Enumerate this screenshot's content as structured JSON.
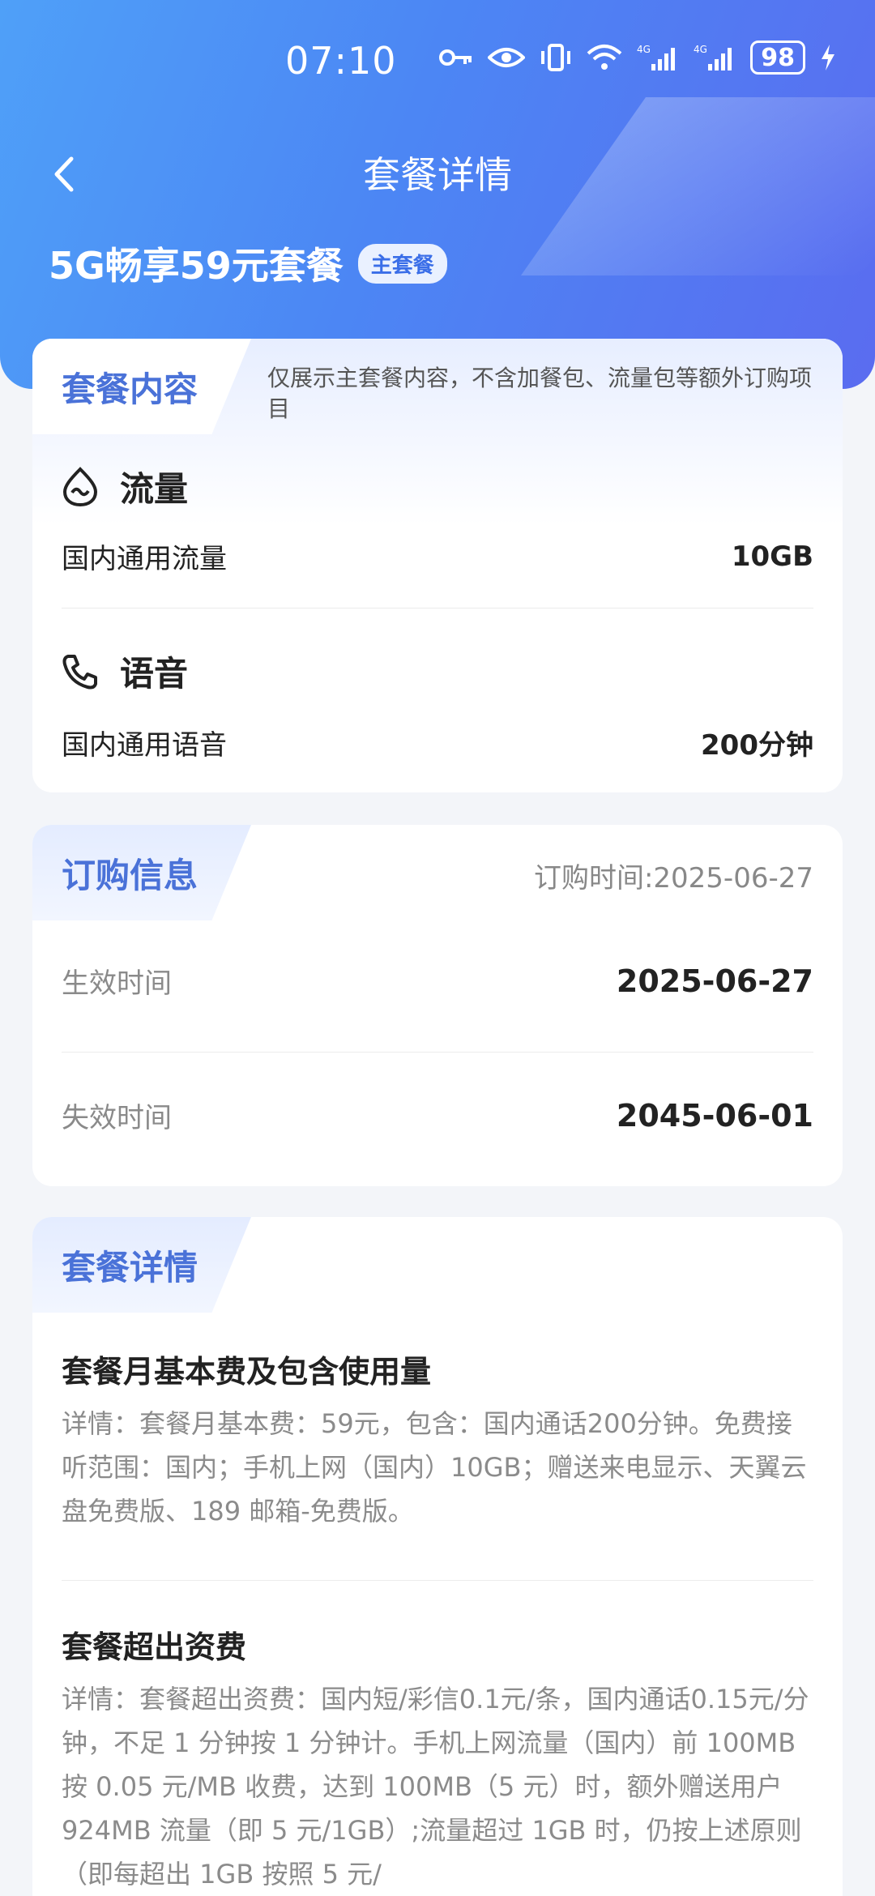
{
  "status_bar": {
    "time": "07:10",
    "battery": "98",
    "icons": [
      "key-icon",
      "eye-icon",
      "vibrate-icon",
      "wifi-icon",
      "signal-4g-icon",
      "signal-4g-icon",
      "charging-icon"
    ]
  },
  "nav": {
    "title": "套餐详情",
    "back_icon": "chevron-left-icon"
  },
  "plan": {
    "name": "5G畅享59元套餐",
    "badge": "主套餐"
  },
  "package_content": {
    "tab": "套餐内容",
    "note": "仅展示主套餐内容，不含加餐包、流量包等额外订购项目",
    "data": {
      "title": "流量",
      "icon": "data-drop-icon",
      "label": "国内通用流量",
      "value": "10GB"
    },
    "voice": {
      "title": "语音",
      "icon": "phone-icon",
      "label": "国内通用语音",
      "value": "200分钟"
    }
  },
  "order_info": {
    "tab": "订购信息",
    "order_time": "订购时间:2025-06-27",
    "effective_label": "生效时间",
    "effective_value": "2025-06-27",
    "expire_label": "失效时间",
    "expire_value": "2045-06-01"
  },
  "details": {
    "tab": "套餐详情",
    "items": [
      {
        "title": "套餐月基本费及包含使用量",
        "text": "详情：套餐月基本费：59元，包含：国内通话200分钟。免费接听范围：国内；手机上网（国内）10GB；赠送来电显示、天翼云盘免费版、189 邮箱-免费版。"
      },
      {
        "title": "套餐超出资费",
        "text": "详情：套餐超出资费：国内短/彩信0.1元/条，国内通话0.15元/分钟，不足 1 分钟按 1 分钟计。手机上网流量（国内）前 100MB 按 0.05 元/MB 收费，达到 100MB（5 元）时，额外赠送用户 924MB 流量（即 5 元/1GB）;流量超过 1GB 时，仍按上述原则（即每超出 1GB 按照 5 元/"
      }
    ]
  },
  "colors": {
    "accent": "#4a72d8",
    "header_start": "#4fa0f8",
    "header_end": "#5a6cf0"
  }
}
